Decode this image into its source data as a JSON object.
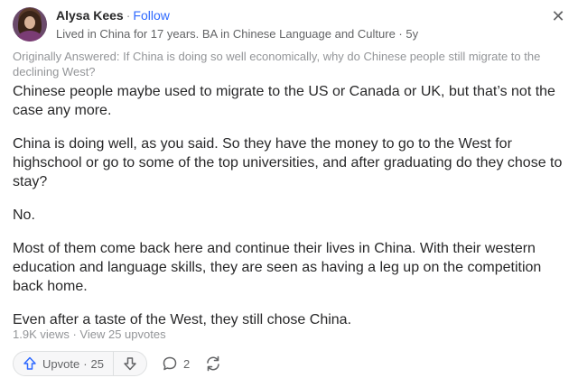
{
  "author": {
    "name": "Alysa Kees",
    "separator": "·",
    "follow_label": "Follow",
    "credential": "Lived in China for 17 years. BA in Chinese Language and Culture · 5y"
  },
  "originally_answered": "Originally Answered: If China is doing so well economically, why do Chinese people still migrate to the declining West?",
  "answer_paragraphs": [
    "Chinese people maybe used to migrate to the US or Canada or UK, but that’s not the case any more.",
    "China is doing well, as you said. So they have the money to go to the West for highschool or go to some of the top universities, and after graduating do they chose to stay?",
    "No.",
    "Most of them come back here and continue their lives in China. With their western education and language skills, they are seen as having a leg up on the competition back home.",
    "Even after a taste of the West, they still chose China."
  ],
  "stats": "1.9K views · View 25 upvotes",
  "actions": {
    "upvote_label": "Upvote",
    "upvote_separator": "·",
    "upvote_count": "25",
    "comment_count": "2"
  },
  "icons": {
    "close": "close-icon",
    "upvote": "upvote-arrow-icon",
    "downvote": "downvote-arrow-icon",
    "comment": "comment-bubble-icon",
    "share": "share-arrows-icon"
  },
  "colors": {
    "link_blue": "#2e69ff",
    "text_primary": "#282829",
    "text_secondary": "#636466",
    "text_muted": "#939598"
  }
}
